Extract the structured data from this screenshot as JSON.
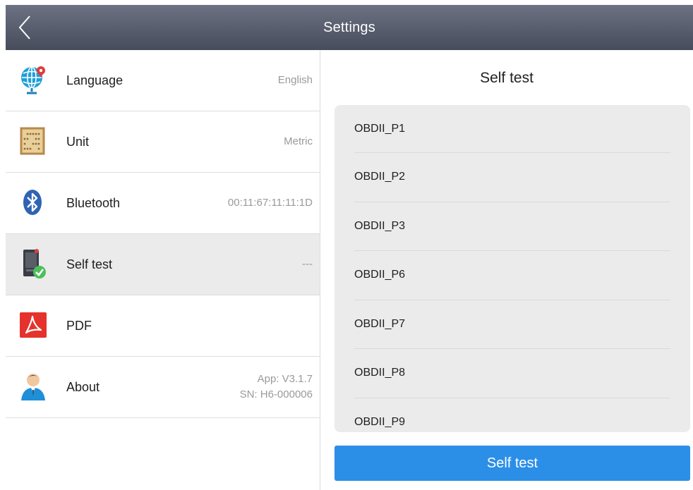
{
  "header": {
    "title": "Settings",
    "back_icon": "chevron-left-icon"
  },
  "settings": [
    {
      "key": "language",
      "label": "Language",
      "value": "English",
      "icon": "globe-location-icon"
    },
    {
      "key": "unit",
      "label": "Unit",
      "value": "Metric",
      "icon": "abacus-icon"
    },
    {
      "key": "bluetooth",
      "label": "Bluetooth",
      "value": "00:11:67:11:11:1D",
      "icon": "bluetooth-icon"
    },
    {
      "key": "self-test",
      "label": "Self test",
      "value": "---",
      "icon": "device-check-icon",
      "selected": true
    },
    {
      "key": "pdf",
      "label": "PDF",
      "value": "",
      "icon": "pdf-icon"
    },
    {
      "key": "about",
      "label": "About",
      "value_line1": "App: V3.1.7",
      "value_line2": "SN: H6-000006",
      "icon": "user-icon"
    }
  ],
  "self_test": {
    "title": "Self test",
    "items": [
      "OBDII_P1",
      "OBDII_P2",
      "OBDII_P3",
      "OBDII_P6",
      "OBDII_P7",
      "OBDII_P8",
      "OBDII_P9"
    ],
    "button_label": "Self test"
  },
  "colors": {
    "header_top": "#6c7283",
    "header_bottom": "#474c5b",
    "accent": "#2b8fe8",
    "selected_row": "#ebebeb"
  }
}
